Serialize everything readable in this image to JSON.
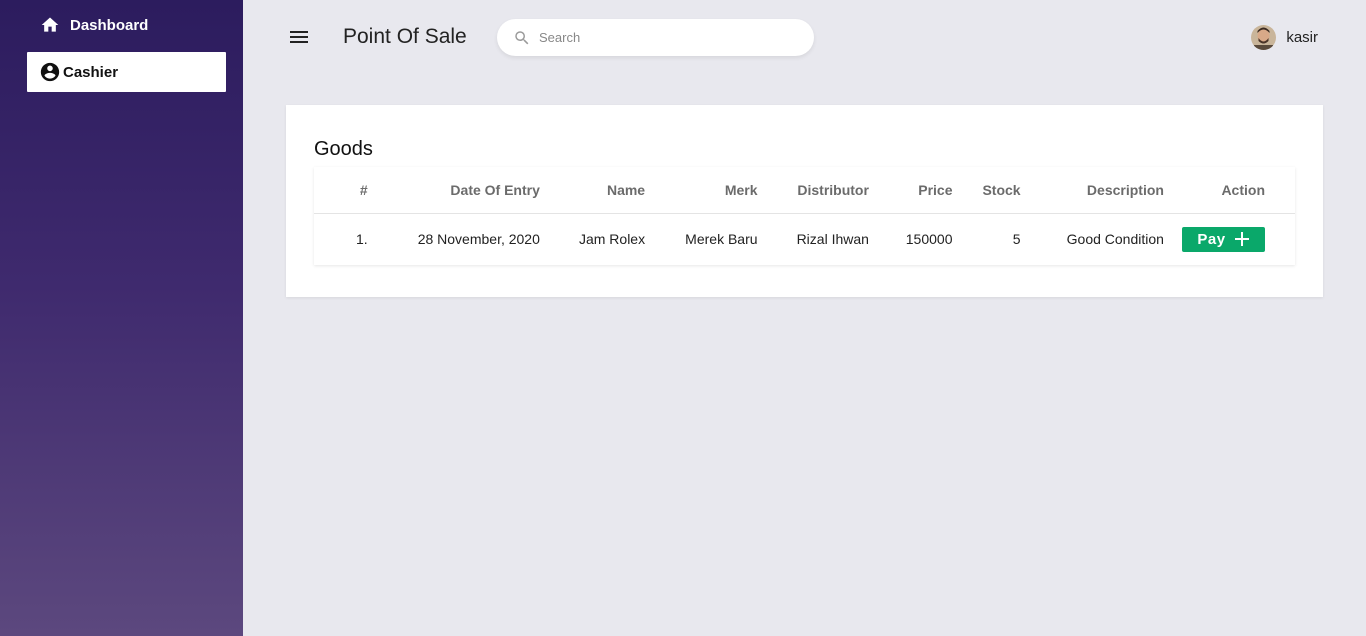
{
  "sidebar": {
    "items": [
      {
        "label": "Dashboard",
        "icon": "home-icon"
      },
      {
        "label": "Cashier",
        "icon": "account-circle-icon"
      }
    ]
  },
  "header": {
    "title": "Point Of Sale",
    "search_placeholder": "Search",
    "user_name": "kasir"
  },
  "goods": {
    "title": "Goods",
    "columns": [
      "#",
      "Date Of Entry",
      "Name",
      "Merk",
      "Distributor",
      "Price",
      "Stock",
      "Description",
      "Action"
    ],
    "rows": [
      {
        "no": "1.",
        "date": "28 November, 2020",
        "name": "Jam Rolex",
        "merk": "Merek Baru",
        "distributor": "Rizal Ihwan",
        "price": "150000",
        "stock": "5",
        "description": "Good Condition",
        "action_label": "Pay"
      }
    ]
  },
  "colors": {
    "sidebar_top": "#2c1c5e",
    "sidebar_bottom": "#5c487e",
    "pay_button": "#0aa86a",
    "background": "#e8e8ee"
  }
}
